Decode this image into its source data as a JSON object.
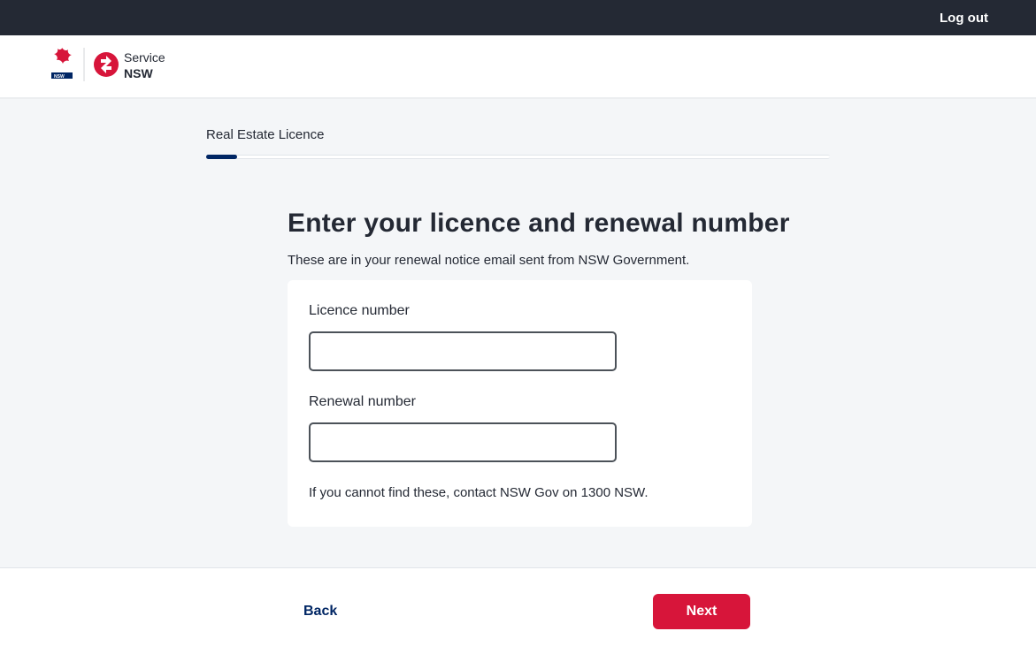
{
  "topbar": {
    "logout": "Log out"
  },
  "breadcrumb": "Real Estate Licence",
  "title": "Enter your licence and renewal number",
  "subtitle": "These are in your renewal notice email sent from NSW Government.",
  "form": {
    "licence_label": "Licence number",
    "licence_value": "",
    "renewal_label": "Renewal number",
    "renewal_value": "",
    "helper": "If you cannot find these, contact NSW Gov on 1300 NSW."
  },
  "footer": {
    "back": "Back",
    "next": "Next"
  },
  "progress_percent": 5
}
